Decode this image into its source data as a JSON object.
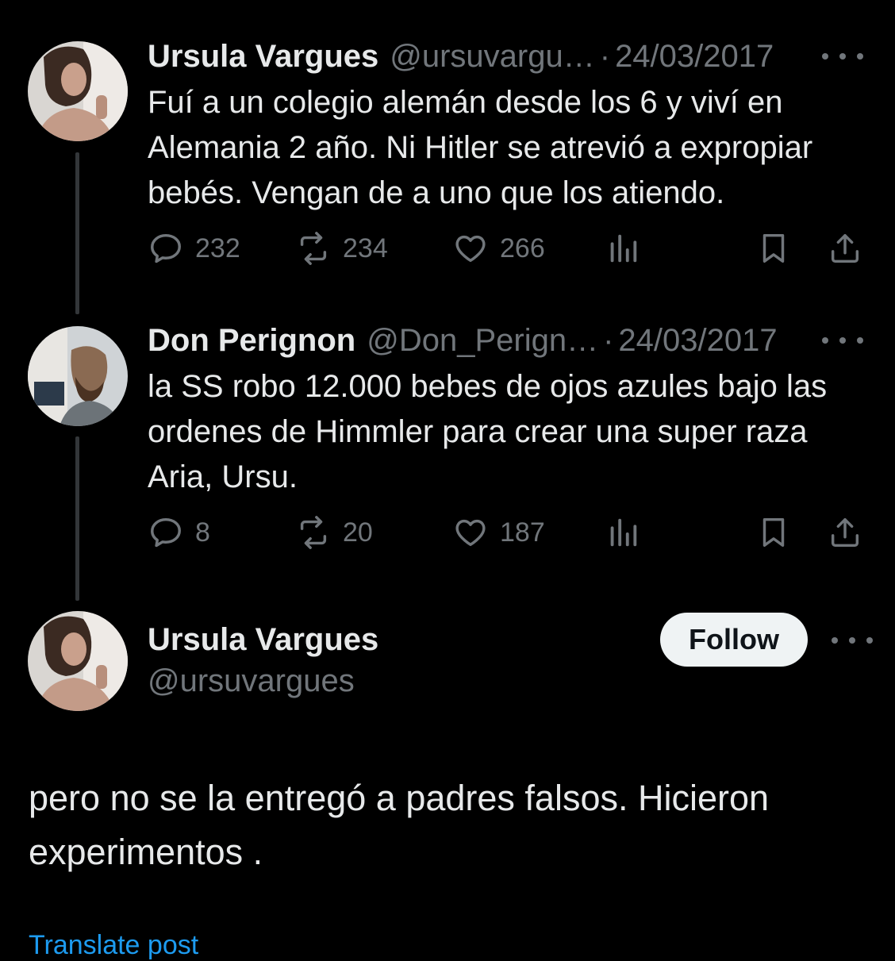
{
  "tweets": [
    {
      "name": "Ursula Vargues",
      "handle": "@ursuvargu…",
      "separator": "·",
      "date": "24/03/2017",
      "text": "Fuí a un colegio alemán desde los 6 y viví en Alemania 2 año. Ni Hitler se atrevió a expropiar bebés. Vengan de a uno que los atiendo.",
      "replies": "232",
      "reposts": "234",
      "likes": "266"
    },
    {
      "name": "Don Perignon",
      "handle": "@Don_Perign…",
      "separator": "·",
      "date": "24/03/2017",
      "text": "la SS robo 12.000 bebes de ojos azules bajo las ordenes de Himmler para crear una super raza Aria, Ursu.",
      "replies": "8",
      "reposts": "20",
      "likes": "187"
    }
  ],
  "main_post": {
    "name": "Ursula Vargues",
    "handle": "@ursuvargues",
    "follow_label": "Follow",
    "text": "pero no se la entregó a padres falsos. Hicieron experimentos .",
    "translate_label": "Translate post"
  },
  "icons": {
    "reply": "reply-icon",
    "repost": "repost-icon",
    "like": "heart-icon",
    "views": "views-icon",
    "bookmark": "bookmark-icon",
    "share": "share-icon",
    "more": "more-icon"
  },
  "colors": {
    "background": "#000000",
    "text": "#e7e9ea",
    "muted": "#71767b",
    "link": "#1d9bf0",
    "follow_bg": "#eff3f4"
  }
}
